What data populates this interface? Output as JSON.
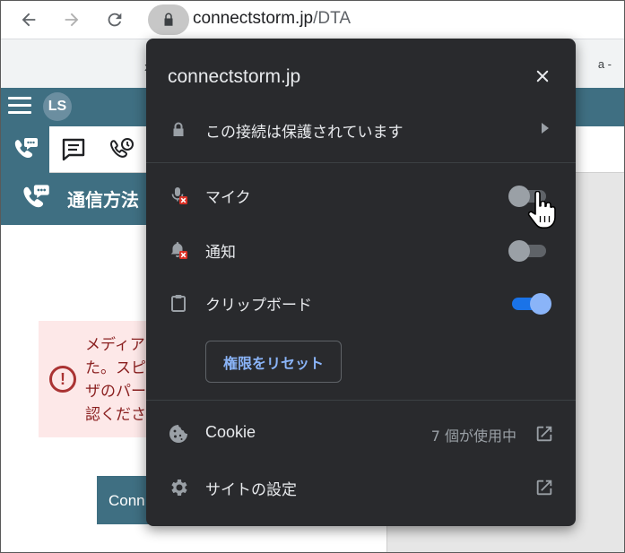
{
  "browser": {
    "url_host": "connectstorm.jp",
    "url_path": "/DTA",
    "bookmark_fragment": "a -",
    "bookmark_dot": "x"
  },
  "app": {
    "avatar_initials": "LS",
    "section_title": "通信方法",
    "alert_lines": [
      "メディア",
      "た。スピ",
      "ザのパー",
      "認くださ"
    ],
    "connect_button": "Conn"
  },
  "popup": {
    "title": "connectstorm.jp",
    "connection_label": "この接続は保護されています",
    "permissions": [
      {
        "label": "マイク",
        "icon": "microphone-blocked-icon",
        "enabled": false
      },
      {
        "label": "通知",
        "icon": "notification-blocked-icon",
        "enabled": false
      },
      {
        "label": "クリップボード",
        "icon": "clipboard-icon",
        "enabled": true
      }
    ],
    "reset_button": "権限をリセット",
    "cookie_label": "Cookie",
    "cookie_status": "7 個が使用中",
    "site_settings_label": "サイトの設定"
  },
  "colors": {
    "popup_bg": "#292a2d",
    "accent_blue": "#8ab4f8",
    "app_teal": "#3f6f82",
    "alert_bg": "#fde8e8"
  }
}
